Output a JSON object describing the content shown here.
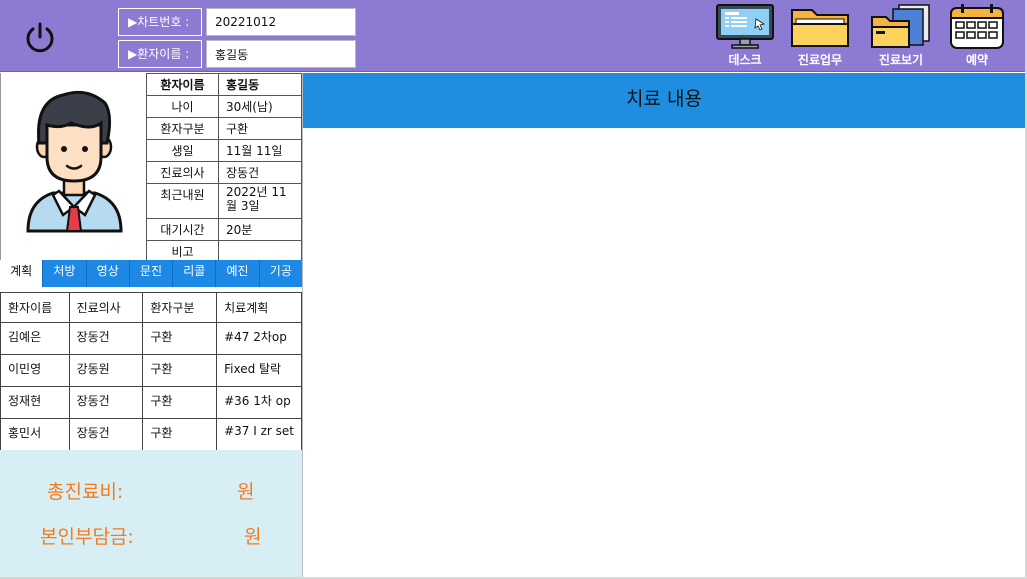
{
  "header": {
    "chart_no_label": "▶차트번호 :",
    "chart_no_value": "20221012",
    "patient_name_label": "▶환자이름 :",
    "patient_name_value": "홍길동",
    "nav": [
      {
        "label": "데스크",
        "icon": "desktop-monitor-icon"
      },
      {
        "label": "진료업무",
        "icon": "folder-icon"
      },
      {
        "label": "진료보기",
        "icon": "folders-documents-icon"
      },
      {
        "label": "예약",
        "icon": "calendar-icon"
      }
    ]
  },
  "patient_info": {
    "rows": [
      {
        "key": "환자이름",
        "value": "홍길동"
      },
      {
        "key": "나이",
        "value": "30세(남)"
      },
      {
        "key": "환자구분",
        "value": "구환"
      },
      {
        "key": "생일",
        "value": "11월 11일"
      },
      {
        "key": "진료의사",
        "value": "장동건"
      },
      {
        "key": "최근내원",
        "value": "2022년 11월 3일"
      },
      {
        "key": "대기시간",
        "value": "20분"
      },
      {
        "key": "비고",
        "value": ""
      }
    ]
  },
  "tabs": [
    "계획",
    "처방",
    "영상",
    "문진",
    "리콜",
    "예진",
    "기공"
  ],
  "active_tab": "계획",
  "patient_list": {
    "columns": [
      "환자이름",
      "진료의사",
      "환자구분",
      "치료계획"
    ],
    "rows": [
      [
        "김예은",
        "장동건",
        "구환",
        "#47 2차op"
      ],
      [
        "이민영",
        "강동원",
        "구환",
        "Fixed 탈락"
      ],
      [
        "정재현",
        "장동건",
        "구환",
        "#36 1차 op"
      ],
      [
        "홍민서",
        "장동건",
        "구환",
        "#37 I zr set"
      ]
    ]
  },
  "cost": {
    "total_label": "총진료비:",
    "total_unit": "원",
    "copay_label": "본인부담금:",
    "copay_unit": "원"
  },
  "main": {
    "title": "치료 내용"
  },
  "colors": {
    "header_bg": "#8d7ad3",
    "accent_blue": "#1e88e5",
    "cost_bg": "#d7eff4",
    "cost_text": "#f37b20"
  }
}
